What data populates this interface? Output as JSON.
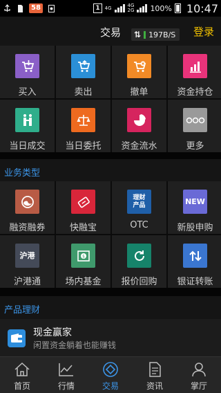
{
  "status_bar": {
    "notification_badge": "58",
    "sim_slot": "1",
    "network_1": "4G",
    "network_2": "4G",
    "network_3": "2G",
    "battery": "100%",
    "time": "10:47"
  },
  "header": {
    "title": "交易",
    "speed": "197B/S",
    "login": "登录"
  },
  "trade_grid": [
    {
      "label": "买入",
      "icon": "cart-down-icon",
      "color": "#8a5fc7"
    },
    {
      "label": "卖出",
      "icon": "cart-up-icon",
      "color": "#2b8fd6"
    },
    {
      "label": "撤单",
      "icon": "cart-cancel-icon",
      "color": "#f28a26"
    },
    {
      "label": "资金持仓",
      "icon": "bar-chart-icon",
      "color": "#e8337a"
    },
    {
      "label": "当日成交",
      "icon": "handshake-icon",
      "color": "#2fae8b"
    },
    {
      "label": "当日委托",
      "icon": "scale-icon",
      "color": "#ee6a1f"
    },
    {
      "label": "资金流水",
      "icon": "pie-chart-icon",
      "color": "#d6245e"
    },
    {
      "label": "更多",
      "icon": "more-dots-icon",
      "color": "#9a9a9a"
    }
  ],
  "business_section": {
    "title": "业务类型"
  },
  "business_grid": [
    {
      "label": "融资融券",
      "icon": "swirl-icon",
      "color": "#b85b45",
      "tile_text": ""
    },
    {
      "label": "快融宝",
      "icon": "ticket-icon",
      "color": "#d8263a",
      "tile_text": ""
    },
    {
      "label": "OTC",
      "icon": "otc-icon",
      "color": "#1f5fa8",
      "tile_text": "理财\n产品"
    },
    {
      "label": "新股申购",
      "icon": "new-icon",
      "color": "#6a6ad6",
      "tile_text": "NEW"
    },
    {
      "label": "沪港通",
      "icon": "hk-icon",
      "color": "#444a58",
      "tile_text": "沪港"
    },
    {
      "label": "场内基金",
      "icon": "fund-icon",
      "color": "#3f9a6c",
      "tile_text": ""
    },
    {
      "label": "报价回购",
      "icon": "refresh-icon",
      "color": "#16836a",
      "tile_text": ""
    },
    {
      "label": "银证转账",
      "icon": "transfer-icon",
      "color": "#3a76d0",
      "tile_text": ""
    }
  ],
  "product_section": {
    "title": "产品理财"
  },
  "product": {
    "title": "现金赢家",
    "subtitle": "闲置资金躺着也能赚钱",
    "icon": "wallet-icon"
  },
  "bottom_nav": [
    {
      "label": "首页",
      "icon": "home-icon",
      "active": false
    },
    {
      "label": "行情",
      "icon": "line-chart-icon",
      "active": false
    },
    {
      "label": "交易",
      "icon": "trade-icon",
      "active": true
    },
    {
      "label": "资讯",
      "icon": "news-icon",
      "active": false
    },
    {
      "label": "掌厅",
      "icon": "person-icon",
      "active": false
    }
  ]
}
